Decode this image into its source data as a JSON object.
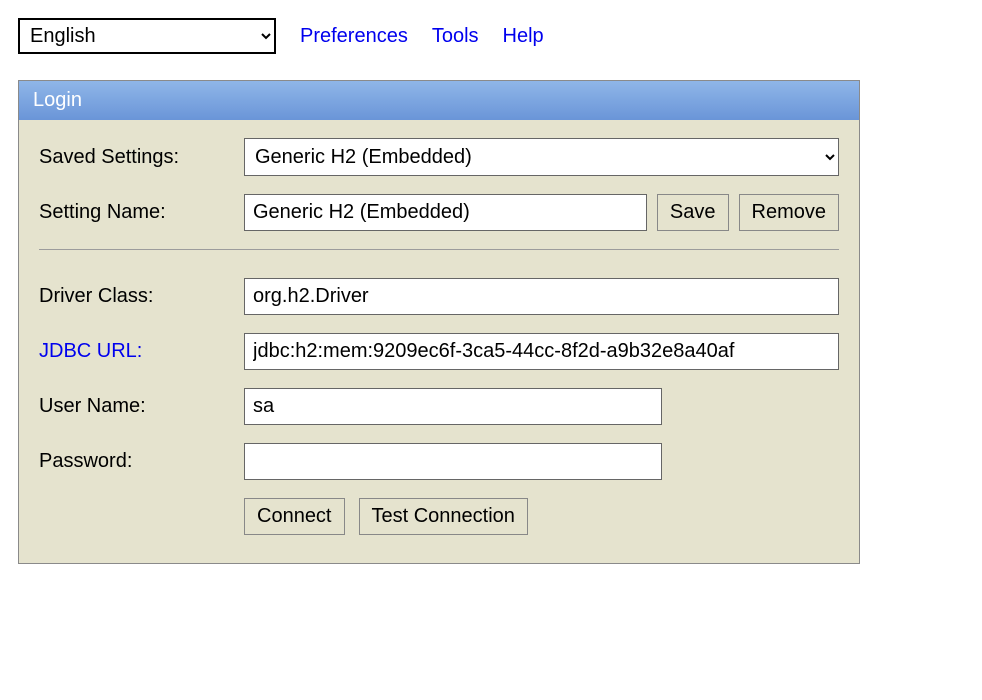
{
  "topbar": {
    "language": {
      "selected": "English",
      "options": [
        "English"
      ]
    },
    "links": {
      "preferences": "Preferences",
      "tools": "Tools",
      "help": "Help"
    }
  },
  "panel": {
    "title": "Login",
    "labels": {
      "saved_settings": "Saved Settings:",
      "setting_name": "Setting Name:",
      "driver_class": "Driver Class:",
      "jdbc_url": "JDBC URL:",
      "user_name": "User Name:",
      "password": "Password:"
    },
    "values": {
      "saved_settings_selected": "Generic H2 (Embedded)",
      "saved_settings_options": [
        "Generic H2 (Embedded)"
      ],
      "setting_name": "Generic H2 (Embedded)",
      "driver_class": "org.h2.Driver",
      "jdbc_url": "jdbc:h2:mem:9209ec6f-3ca5-44cc-8f2d-a9b32e8a40af",
      "user_name": "sa",
      "password": ""
    },
    "buttons": {
      "save": "Save",
      "remove": "Remove",
      "connect": "Connect",
      "test_connection": "Test Connection"
    }
  }
}
